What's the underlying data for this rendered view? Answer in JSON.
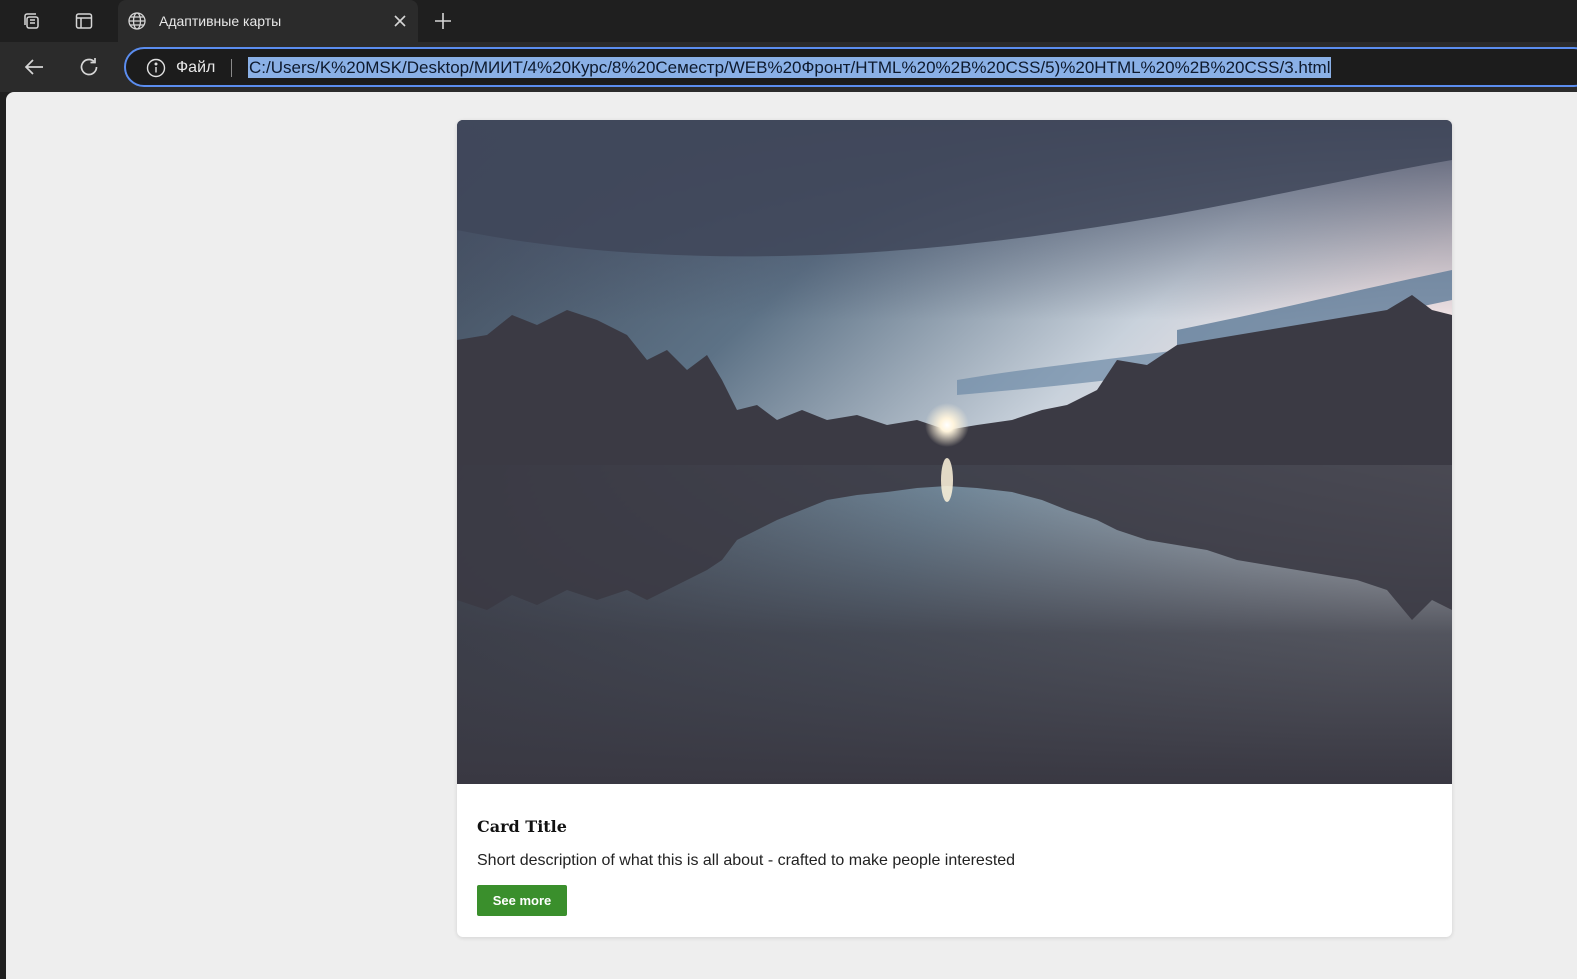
{
  "browser": {
    "tab": {
      "title": "Адаптивные карты"
    },
    "address_bar": {
      "scheme_label": "Файл",
      "url": "C:/Users/K%20MSK/Desktop/МИИТ/4%20Курс/8%20Семестр/WEB%20Фронт/HTML%20%2B%20CSS/5)%20HTML%20%2B%20CSS/3.html"
    },
    "icons": {
      "workspaces": "workspaces-icon",
      "tab_actions": "tab-actions-icon",
      "favicon": "globe-icon",
      "close_tab": "close-icon",
      "new_tab": "plus-icon",
      "back": "back-arrow-icon",
      "refresh": "refresh-icon",
      "site_info": "info-icon"
    },
    "colors": {
      "chrome_dark": "#1f1f1f",
      "toolbar": "#2b2b2b",
      "address_focus": "#5b8def",
      "url_selection": "#8ab0e6"
    }
  },
  "page": {
    "background": "#eeeeee",
    "card": {
      "image_alt": "night lake landscape",
      "title": "Card Title",
      "description": "Short description of what this is all about - crafted to make people interested",
      "button_label": "See more",
      "button_color": "#3a8f2c"
    }
  }
}
